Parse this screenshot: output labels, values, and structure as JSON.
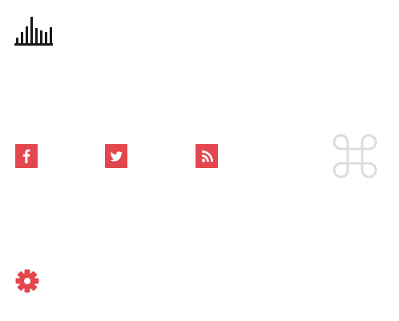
{
  "icons": {
    "logo": "bar-chart-logo-icon",
    "social": [
      "facebook-icon",
      "twitter-icon",
      "rss-icon"
    ],
    "command": "command-key-icon",
    "settings": "gear-icon"
  },
  "colors": {
    "accent": "#e3474d",
    "logo": "#1a1a1a",
    "command_icon": "#dcdcdc",
    "background": "#ffffff"
  }
}
